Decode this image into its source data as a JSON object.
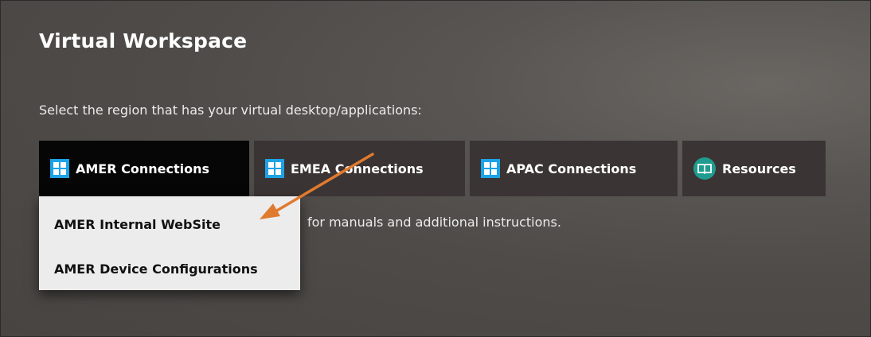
{
  "page": {
    "title": "Virtual Workspace",
    "subtitle": "Select the region that has your virtual desktop/applications:",
    "helptext": "for manuals and additional instructions."
  },
  "tabs": [
    {
      "label": "AMER Connections",
      "icon": "windows-icon",
      "active": true
    },
    {
      "label": "EMEA Connections",
      "icon": "windows-icon",
      "active": false
    },
    {
      "label": "APAC Connections",
      "icon": "windows-icon",
      "active": false
    },
    {
      "label": "Resources",
      "icon": "book-icon",
      "active": false
    }
  ],
  "dropdown": {
    "items": [
      "AMER Internal WebSite",
      "AMER Device Configurations"
    ]
  },
  "colors": {
    "background": "#4e4b48",
    "tab": "#3b3434",
    "tab_active": "#060606",
    "windows_icon": "#1da2e6",
    "book_icon": "#1f9c8f",
    "annotation_arrow": "#e07a2e"
  }
}
